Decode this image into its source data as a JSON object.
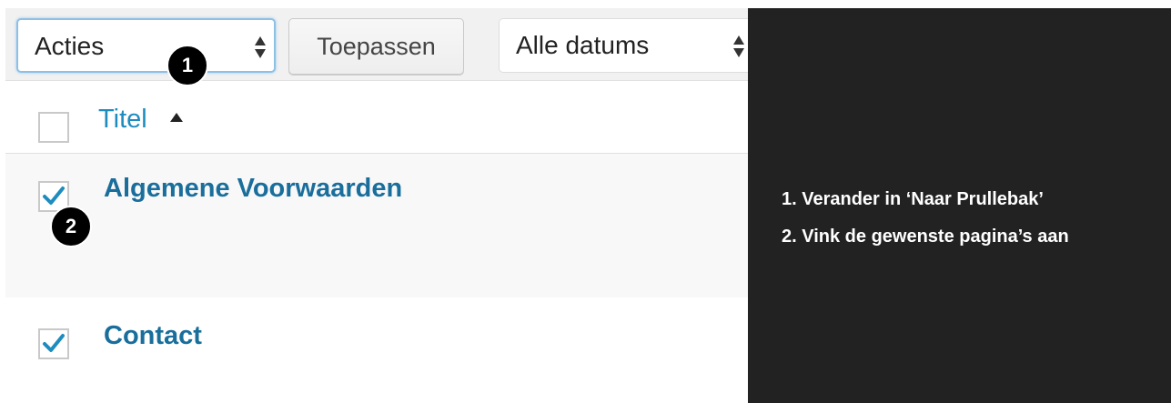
{
  "toolbar": {
    "bulk_actions_value": "Acties",
    "apply_label": "Toepassen",
    "date_filter_value": "Alle datums"
  },
  "table": {
    "header": {
      "title_label": "Titel",
      "sort_icon": "sort-ascending-icon"
    },
    "rows": [
      {
        "title": "Algemene Voorwaarden",
        "checked": true
      },
      {
        "title": "Contact",
        "checked": true
      }
    ]
  },
  "badges": [
    "1",
    "2"
  ],
  "instructions": [
    "1. Verander in ‘Naar Prullebak’",
    "2. Vink de gewenste pagina’s aan"
  ],
  "colors": {
    "link": "#1e8cbe",
    "panel": "#222222",
    "check": "#1e8cbe"
  }
}
